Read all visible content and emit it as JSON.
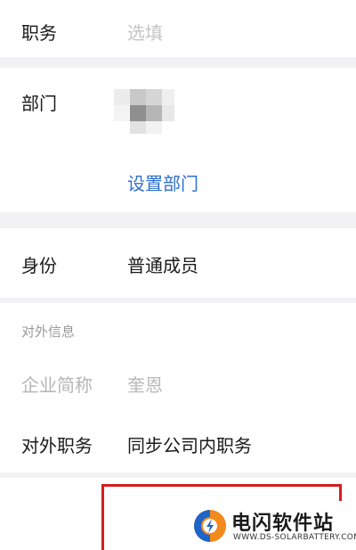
{
  "fields": {
    "position": {
      "label": "职务",
      "placeholder": "选填"
    },
    "department": {
      "label": "部门",
      "action": "设置部门"
    },
    "identity": {
      "label": "身份",
      "value": "普通成员"
    }
  },
  "external": {
    "header": "对外信息",
    "company_short": {
      "label": "企业简称",
      "value": "奎恩"
    },
    "external_position": {
      "label": "对外职务",
      "value": "同步公司内职务"
    }
  },
  "colors": {
    "link": "#2f6fd0",
    "highlight": "#d21e1e",
    "background": "#f2f2f4"
  },
  "watermark": {
    "title": "电闪软件站",
    "url": "WWW.DS-SOLARBATTERY.COM",
    "logo_icon": "site-logo-icon"
  }
}
